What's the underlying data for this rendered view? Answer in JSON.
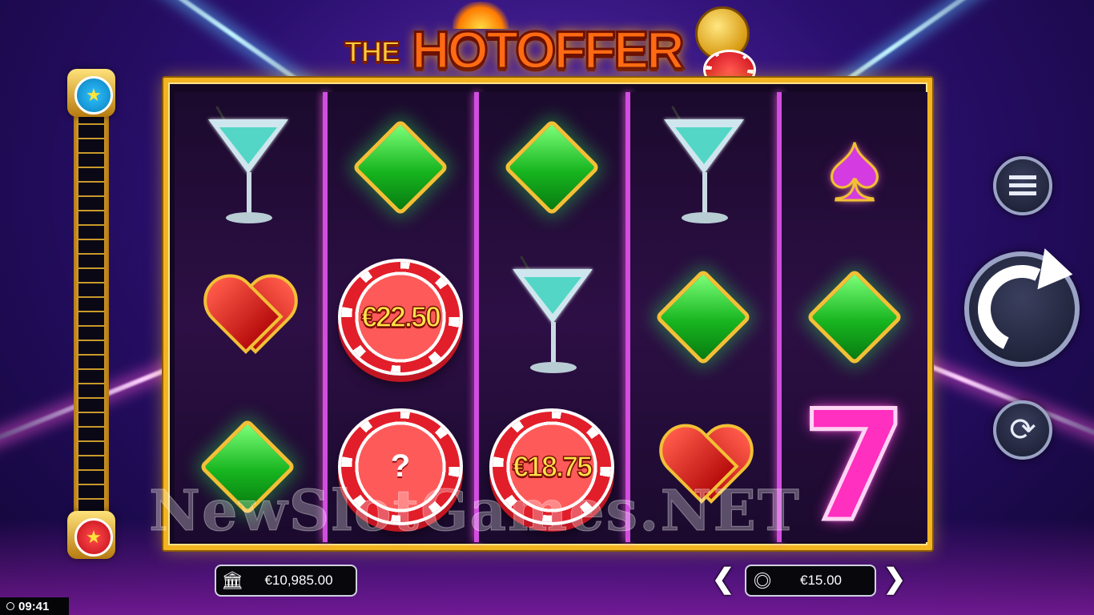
{
  "game": {
    "title_small": "THE",
    "title_main": "HOTOFFER"
  },
  "reels": [
    [
      "martini",
      "heart",
      "diamond"
    ],
    [
      "diamond",
      "chip",
      "chip-mystery"
    ],
    [
      "diamond",
      "martini",
      "chip"
    ],
    [
      "martini",
      "diamond",
      "heart"
    ],
    [
      "spade",
      "diamond",
      "seven"
    ]
  ],
  "chips": {
    "reel2_row2": "€22.50",
    "reel2_row3": "?",
    "reel3_row3": "€18.75"
  },
  "icons": {
    "meter_top": "star-blue-chip-icon",
    "meter_bottom": "star-red-chip-icon",
    "menu": "hamburger-menu-icon",
    "spin": "spin-arrow-icon",
    "autoplay": "autoplay-arrows-icon",
    "balance": "bank-icon",
    "bet": "chip-icon",
    "clock": "clock-icon"
  },
  "watermark": "NewSlotGames.NET",
  "balance": {
    "value": "€10,985.00"
  },
  "bet": {
    "value": "€15.00",
    "decrease": "❮",
    "increase": "❯"
  },
  "clock": {
    "time": "09:41"
  },
  "colors": {
    "frame": "#f3b422",
    "divider": "#d24de0",
    "background": "#2a0f6e"
  }
}
